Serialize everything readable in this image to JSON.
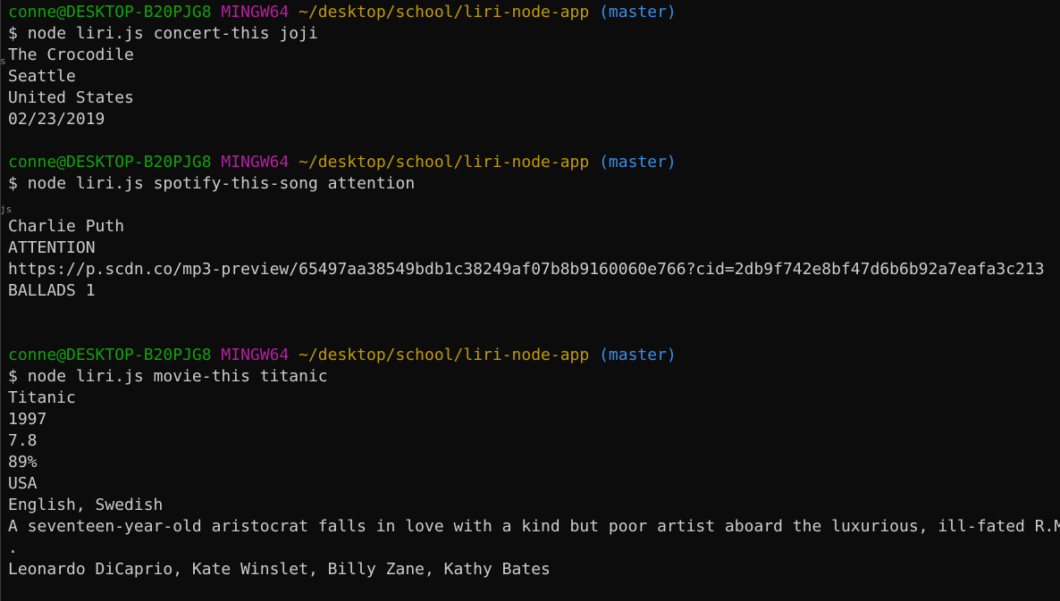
{
  "prompt": {
    "user_host": "conne@DESKTOP-B20PJG8",
    "shell": "MINGW64",
    "path": "~/desktop/school/liri-node-app",
    "branch": "(master)",
    "symbol": "$"
  },
  "commands": {
    "concert": "node liri.js concert-this joji",
    "spotify": "node liri.js spotify-this-song attention",
    "movie": "node liri.js movie-this titanic"
  },
  "concert_output": {
    "venue": "The Crocodile",
    "city": "Seattle",
    "country": "United States",
    "date": "02/23/2019"
  },
  "spotify_output": {
    "artist": "Charlie Puth",
    "song": "ATTENTION",
    "preview_url": "https://p.scdn.co/mp3-preview/65497aa38549bdb1c38249af07b8b9160060e766?cid=2db9f742e8bf47d6b6b92a7eafa3c213",
    "album": "BALLADS 1"
  },
  "movie_output": {
    "title": "Titanic",
    "year": "1997",
    "imdb_rating": "7.8",
    "rotten_tomatoes": "89%",
    "country": "USA",
    "languages": "English, Swedish",
    "plot": "A seventeen-year-old aristocrat falls in love with a kind but poor artist aboard the luxurious, ill-fated R.M.S. Titanic",
    "plot_wrap": ".",
    "actors": "Leonardo DiCaprio, Kate Winslet, Billy Zane, Kathy Bates"
  },
  "gutter": {
    "mark1": "s",
    "mark2": "js"
  }
}
